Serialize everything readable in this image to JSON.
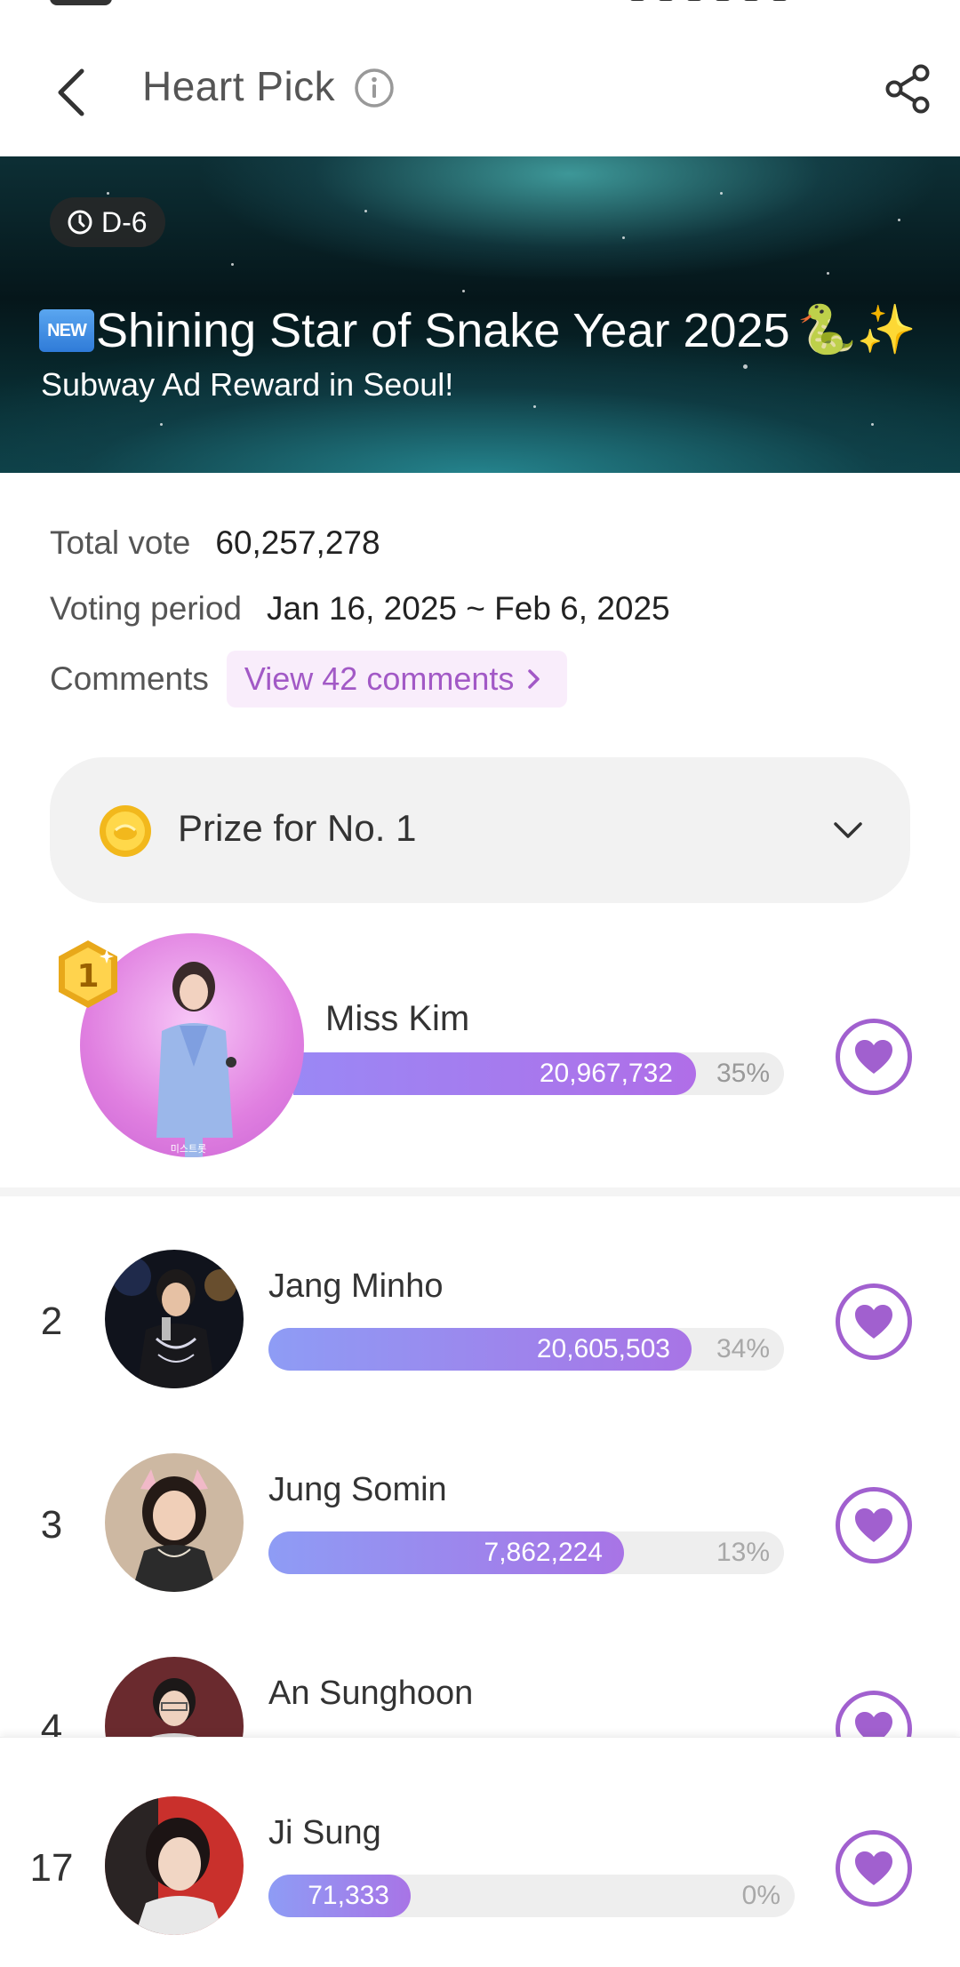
{
  "header": {
    "title": "Heart Pick",
    "back_icon": "chevron-left-icon",
    "info_icon": "info-icon",
    "share_icon": "share-icon"
  },
  "banner": {
    "dday": "D-6",
    "new_badge": "NEW",
    "title": "Shining Star of Snake Year 2025",
    "title_emoji": "🐍✨",
    "subtitle": "Subway Ad Reward in Seoul!"
  },
  "info": {
    "total_vote_label": "Total vote",
    "total_vote_value": "60,257,278",
    "voting_period_label": "Voting period",
    "voting_period_value": "Jan 16, 2025 ~ Feb 6, 2025",
    "comments_label": "Comments",
    "comments_link": "View 42 comments"
  },
  "prize": {
    "label": "Prize for No. 1",
    "icon": "coin-icon"
  },
  "ranking": [
    {
      "rank": "1",
      "name": "Miss Kim",
      "votes": "20,967,732",
      "percent": "35%",
      "fill": 0.82,
      "avatar_caption": "미스트롯"
    },
    {
      "rank": "2",
      "name": "Jang Minho",
      "votes": "20,605,503",
      "percent": "34%",
      "fill": 0.82
    },
    {
      "rank": "3",
      "name": "Jung Somin",
      "votes": "7,862,224",
      "percent": "13%",
      "fill": 0.69
    },
    {
      "rank": "4",
      "name": "An Sunghoon",
      "votes": "",
      "percent": "",
      "fill": 0
    }
  ],
  "my_pick": {
    "rank": "17",
    "name": "Ji Sung",
    "votes": "71,333",
    "percent": "0%",
    "fill": 0.27
  },
  "colors": {
    "accent": "#a160cf",
    "bar_start": "#8e9cf5",
    "bar_end": "#a874e6",
    "comments_bg": "#f9edfb"
  }
}
